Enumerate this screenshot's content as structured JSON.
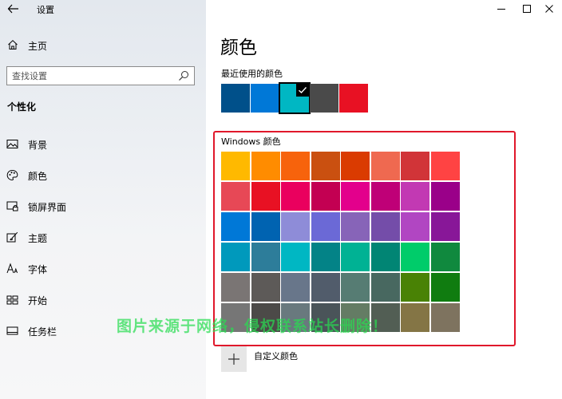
{
  "window": {
    "title": "设置",
    "controls": [
      "minimize-icon",
      "maximize-icon",
      "close-icon"
    ]
  },
  "sidebar": {
    "home_label": "主页",
    "search_placeholder": "查找设置",
    "section_title": "个性化",
    "items": [
      {
        "label": "背景",
        "icon": "picture-icon"
      },
      {
        "label": "颜色",
        "icon": "palette-icon"
      },
      {
        "label": "锁屏界面",
        "icon": "lock-screen-icon"
      },
      {
        "label": "主题",
        "icon": "theme-brush-icon"
      },
      {
        "label": "字体",
        "icon": "font-icon"
      },
      {
        "label": "开始",
        "icon": "start-menu-icon"
      },
      {
        "label": "任务栏",
        "icon": "taskbar-icon"
      }
    ]
  },
  "main": {
    "title": "颜色",
    "recent_label": "最近使用的颜色",
    "recent_colors": [
      "#00508a",
      "#0078d7",
      "#00b7c3",
      "#4a4a4a",
      "#e81123"
    ],
    "selected_recent_index": 2,
    "windows_colors_label": "Windows 颜色",
    "windows_colors": [
      [
        "#ffb900",
        "#ff8c00",
        "#f7630c",
        "#ca5010",
        "#da3b01",
        "#ef6950",
        "#d13438",
        "#ff4343"
      ],
      [
        "#e74856",
        "#e81123",
        "#ea005e",
        "#c30052",
        "#e3008c",
        "#bf0077",
        "#c239b3",
        "#9a0089"
      ],
      [
        "#0078d7",
        "#0063b1",
        "#8e8cd8",
        "#6b69d6",
        "#8764b8",
        "#744da9",
        "#b146c2",
        "#881798"
      ],
      [
        "#0099bc",
        "#2d7d9a",
        "#00b7c3",
        "#038387",
        "#00b294",
        "#018574",
        "#00cc6a",
        "#10893e"
      ],
      [
        "#7a7574",
        "#5d5a58",
        "#68768a",
        "#515c6b",
        "#567c73",
        "#486860",
        "#498205",
        "#107c10"
      ],
      [
        "#767676",
        "#4c4a48",
        "#69797e",
        "#4a5459",
        "#647c64",
        "#525e54",
        "#847545",
        "#7e735f"
      ]
    ],
    "custom_label": "自定义颜色"
  },
  "watermark": "图片来源于网络，侵权联系站长删除！"
}
